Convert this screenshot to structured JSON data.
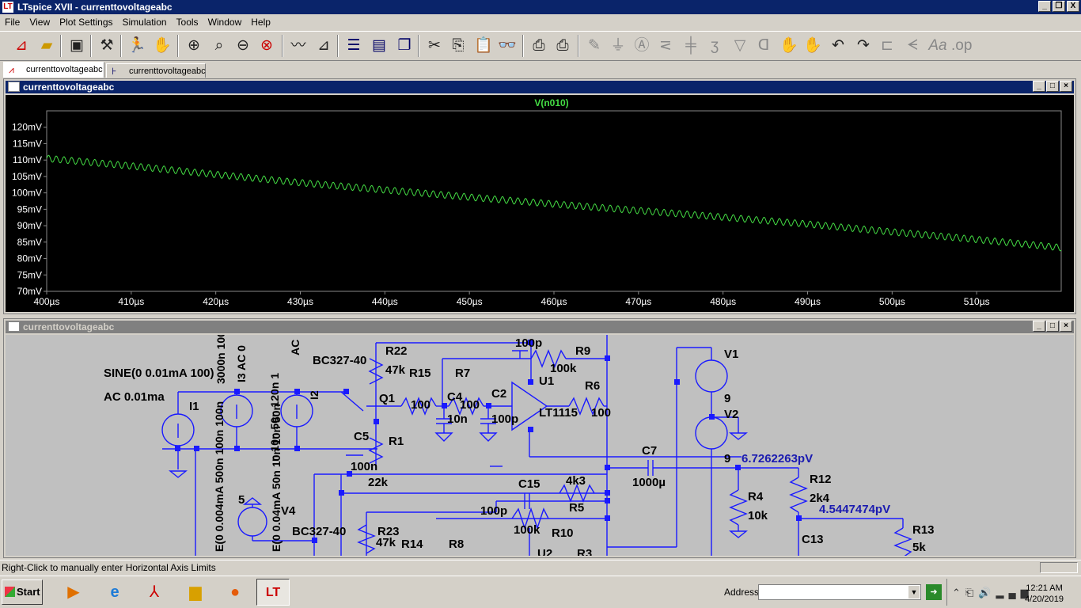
{
  "window": {
    "title": "LTspice XVII - currenttovoltageabc",
    "icon": "LT"
  },
  "window_buttons": [
    "_",
    "❐",
    "X"
  ],
  "menu": [
    "File",
    "View",
    "Plot Settings",
    "Simulation",
    "Tools",
    "Window",
    "Help"
  ],
  "toolbar_icons": [
    "new-schematic-icon",
    "open-icon",
    "save-icon",
    "control-panel-icon",
    "run-icon",
    "halt-icon",
    "zoom-in-icon",
    "zoom-area-icon",
    "zoom-out-icon",
    "zoom-cancel-icon",
    "autorange-icon",
    "marker-icon",
    "tile-horizontal-icon",
    "tile-vertical-icon",
    "cascade-icon",
    "cut-icon",
    "copy-icon",
    "paste-icon",
    "find-icon",
    "print-icon",
    "print-setup-icon",
    "wire-icon",
    "ground-icon",
    "label-icon",
    "resistor-icon",
    "capacitor-icon",
    "inductor-icon",
    "diode-icon",
    "component-icon",
    "move-icon",
    "drag-icon",
    "undo-icon",
    "redo-icon",
    "rotate-icon",
    "mirror-icon",
    "text-icon",
    "spice-directive-icon"
  ],
  "tabs": [
    {
      "label": "currenttovoltageabc",
      "icon": "waveform-icon"
    },
    {
      "label": "currenttovoltageabc",
      "icon": "schematic-icon"
    }
  ],
  "plot_window": {
    "title": "currenttovoltageabc",
    "trace_label": "V(n010)",
    "trace_color": "#44dd44"
  },
  "chart_data": {
    "type": "line",
    "title": "V(n010)",
    "xlabel": "",
    "ylabel": "",
    "xlim": [
      400,
      520
    ],
    "ylim": [
      70,
      125
    ],
    "x_ticks": [
      "400µs",
      "410µs",
      "420µs",
      "430µs",
      "440µs",
      "450µs",
      "460µs",
      "470µs",
      "480µs",
      "490µs",
      "500µs",
      "510µs"
    ],
    "y_ticks": [
      "70mV",
      "75mV",
      "80mV",
      "85mV",
      "90mV",
      "95mV",
      "100mV",
      "105mV",
      "110mV",
      "115mV",
      "120mV"
    ],
    "series": [
      {
        "name": "V(n010)",
        "x_unit": "µs",
        "y_unit": "mV",
        "x": [
          400,
          410,
          420,
          430,
          440,
          450,
          460,
          470,
          480,
          490,
          500,
          510,
          520
        ],
        "y": [
          110.5,
          108.2,
          105.6,
          103.1,
          100.9,
          98.7,
          96.6,
          94.6,
          92.6,
          90.5,
          88.1,
          85.8,
          83.3
        ],
        "ripple_amplitude_mv": 1.0,
        "ripple_period_us": 0.91
      }
    ],
    "grid": false,
    "trace_color": "#44dd44"
  },
  "schematic_window": {
    "title": "currenttovoltageabc",
    "labels": [
      {
        "t": "SINE(0 0.01mA 100)",
        "b": true
      },
      {
        "t": "AC 0.01ma",
        "b": true
      },
      {
        "t": "I1",
        "b": true
      },
      {
        "t": "BC327-40",
        "b": true
      },
      {
        "t": "R22",
        "b": true
      },
      {
        "t": "47k",
        "b": true
      },
      {
        "t": "R15",
        "b": true
      },
      {
        "t": "R7",
        "b": true
      },
      {
        "t": "100",
        "b": true
      },
      {
        "t": "100",
        "b": true
      },
      {
        "t": "C4",
        "b": true
      },
      {
        "t": "C2",
        "b": true
      },
      {
        "t": "10n",
        "b": true
      },
      {
        "t": "100p",
        "b": true
      },
      {
        "t": "Q1",
        "b": true
      },
      {
        "t": "C5",
        "b": true
      },
      {
        "t": "R1",
        "b": true
      },
      {
        "t": "100n",
        "b": true
      },
      {
        "t": "22k",
        "b": true
      },
      {
        "t": "100p",
        "b": true
      },
      {
        "t": "R9",
        "b": true
      },
      {
        "t": "100k",
        "b": true
      },
      {
        "t": "U1",
        "b": true
      },
      {
        "t": "R6",
        "b": true
      },
      {
        "t": "LT1115",
        "b": true
      },
      {
        "t": "100",
        "b": true
      },
      {
        "t": "V1",
        "b": true
      },
      {
        "t": "9",
        "b": true
      },
      {
        "t": "V2",
        "b": true
      },
      {
        "t": "9",
        "b": true
      },
      {
        "t": "C7",
        "b": true
      },
      {
        "t": "1000µ",
        "b": true
      },
      {
        "t": "6.7262263pV",
        "b": true,
        "blue": true
      },
      {
        "t": "R12",
        "b": true
      },
      {
        "t": "2k4",
        "b": true
      },
      {
        "t": "R4",
        "b": true
      },
      {
        "t": "10k",
        "b": true
      },
      {
        "t": "4.5447474pV",
        "b": true,
        "blue": true
      },
      {
        "t": "R13",
        "b": true
      },
      {
        "t": "5k",
        "b": true
      },
      {
        "t": "C13",
        "b": true
      },
      {
        "t": "C15",
        "b": true
      },
      {
        "t": "4k3",
        "b": true
      },
      {
        "t": "R5",
        "b": true
      },
      {
        "t": "100p",
        "b": true
      },
      {
        "t": "100k",
        "b": true
      },
      {
        "t": "R10",
        "b": true
      },
      {
        "t": "5",
        "b": true
      },
      {
        "t": "V4",
        "b": true
      },
      {
        "t": "BC327-40",
        "b": true
      },
      {
        "t": "R23",
        "b": true
      },
      {
        "t": "47k",
        "b": true
      },
      {
        "t": "R14",
        "b": true
      },
      {
        "t": "R8",
        "b": true
      },
      {
        "t": "U2",
        "b": true
      },
      {
        "t": "R3",
        "b": true
      }
    ],
    "vertical_labels": [
      {
        "t": "I3 AC 0"
      },
      {
        "t": "3000n 100n 100n 1"
      },
      {
        "t": "I2"
      },
      {
        "t": "AC"
      },
      {
        "t": "n 10n 50n 120n 1"
      },
      {
        "t": "E(0 0.004mA 500n 100n 100n"
      },
      {
        "t": "E(0 0.04mA 50n 10n 10n 50n"
      }
    ]
  },
  "status": {
    "text": "Right-Click to manually enter Horizontal Axis Limits"
  },
  "taskbar": {
    "start_label": "Start",
    "apps": [
      "media-player-icon",
      "internet-explorer-icon",
      "acrobat-icon",
      "folder-icon",
      "firefox-icon",
      "ltspice-icon"
    ],
    "address_label": "Address",
    "address_value": "",
    "clock_time": "12:21 AM",
    "clock_date": "4/20/2019"
  }
}
